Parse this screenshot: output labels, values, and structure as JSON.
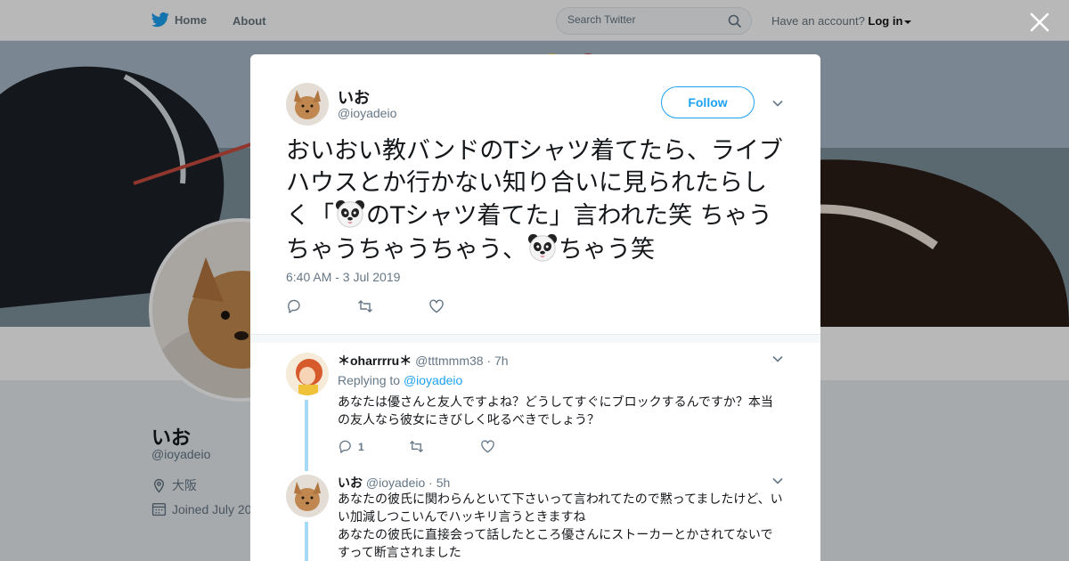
{
  "nav": {
    "home_label": "Home",
    "about_label": "About",
    "search_placeholder": "Search Twitter",
    "account_prompt": "Have an account?",
    "login_label": "Log in"
  },
  "profile": {
    "name": "いお",
    "handle": "@ioyadeio",
    "location": "大阪",
    "joined": "Joined July 20"
  },
  "tweet": {
    "name": "いお",
    "handle": "@ioyadeio",
    "follow_label": "Follow",
    "text_part1": "おいおい教バンドのTシャツ着てたら、ライブハウスとか行かない知り合いに見られたらしく「",
    "text_part2": "のTシャツ着てた」言われた笑 ちゃうちゃうちゃうちゃう、",
    "text_part3": "ちゃう笑",
    "timestamp": "6:40 AM - 3 Jul 2019",
    "reply_count": "",
    "retweet_count": "",
    "like_count": ""
  },
  "replies": [
    {
      "name": "＊oharrrru＊",
      "handle": "@tttmmm38",
      "time": "· 7h",
      "replying_prefix": "Replying to",
      "replying_to": "@ioyadeio",
      "text": "あなたは優さんと友人ですよね？どうしてすぐにブロックするんですか？本当の友人なら彼女にきびしく叱るべきでしょう？",
      "reply_count": "1",
      "retweet_count": "",
      "like_count": ""
    },
    {
      "name": "いお",
      "handle": "@ioyadeio",
      "time": "· 5h",
      "text_line1": "あなたの彼氏に関わらんといて下さいって言われてたので黙ってましたけど、いい加減しつこいんでハッキリ言うときますね",
      "text_line2": "あなたの彼氏に直接会って話したところ優さんにストーカーとかされてないですって断言されました"
    }
  ],
  "colors": {
    "accent": "#1da1f2",
    "muted": "#657786",
    "thread_line": "#a4d9f9"
  },
  "icons": [
    "twitter-bird-icon",
    "search-icon",
    "close-icon",
    "chevron-down-icon",
    "reply-icon",
    "retweet-icon",
    "like-icon",
    "location-icon",
    "calendar-icon",
    "panda-emoji-icon"
  ]
}
